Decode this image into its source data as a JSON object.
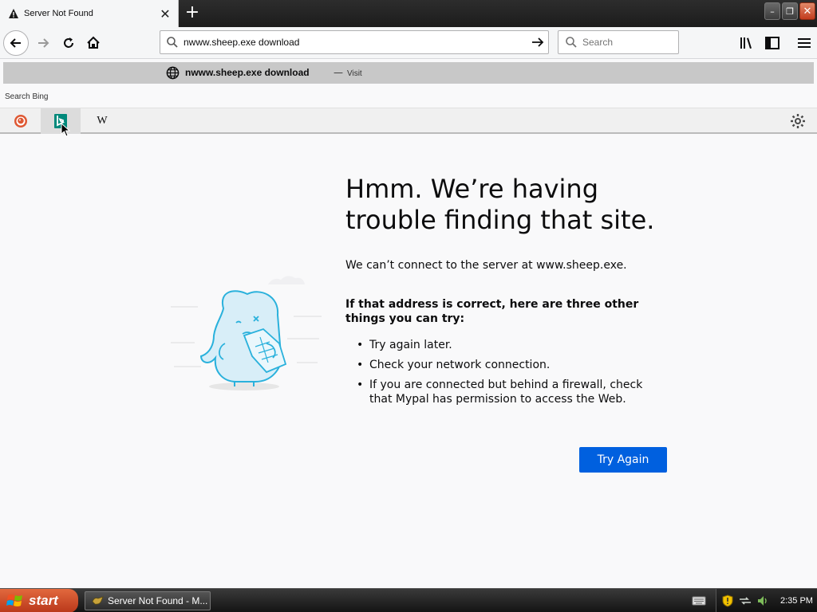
{
  "tab": {
    "title": "Server Not Found",
    "close": "✕"
  },
  "new_tab": "+",
  "window_buttons": {
    "minimize": "–",
    "maximize": "❐",
    "close": "✕"
  },
  "urlbar": {
    "value": "nwww.sheep.exe download"
  },
  "searchbar": {
    "placeholder": "Search"
  },
  "suggestion": {
    "text": "nwww.sheep.exe download",
    "separator": "—",
    "action": "Visit"
  },
  "search_with": {
    "prefix": "Search",
    "engine": "Bing"
  },
  "engines": [
    {
      "name": "DuckDuckGo",
      "icon": "duckduckgo-icon"
    },
    {
      "name": "Bing",
      "icon": "bing-icon",
      "selected": true
    },
    {
      "name": "Wikipedia",
      "icon": "wikipedia-icon",
      "glyph": "W"
    }
  ],
  "error": {
    "title": "Hmm. We’re having trouble finding that site.",
    "description": "We can’t connect to the server at www.sheep.exe.",
    "subheading": "If that address is correct, here are three other things you can try:",
    "suggestions": [
      "Try again later.",
      "Check your network connection.",
      "If you are connected but behind a firewall, check that Mypal has permission to access the Web."
    ],
    "button": "Try Again"
  },
  "taskbar": {
    "start": "start",
    "task": "Server Not Found - M...",
    "clock": "2:35 PM"
  },
  "colors": {
    "accent": "#0060df",
    "start": "#c9421f",
    "tabstrip": "#1c1c1c"
  }
}
